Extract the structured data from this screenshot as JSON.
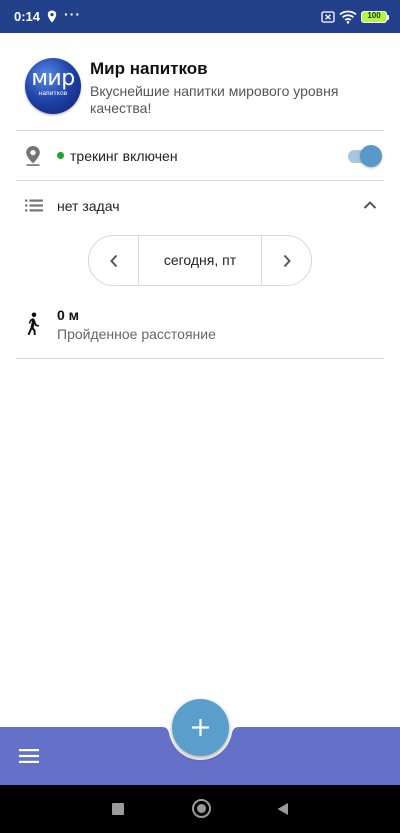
{
  "status_bar": {
    "time": "0:14",
    "more_dots": "···",
    "battery": "100"
  },
  "header": {
    "logo_text": "мир",
    "logo_subtext": "напитков",
    "title": "Мир напитков",
    "subtitle": "Вкуснейшие напитки мирового уровня качества!"
  },
  "tracking": {
    "label": "трекинг включен",
    "enabled": true,
    "status_color": "#1aa32a"
  },
  "tasks": {
    "label": "нет задач",
    "expanded": true
  },
  "date_nav": {
    "label": "сегодня, пт"
  },
  "distance": {
    "value": "0 м",
    "label": "Пройденное расстояние"
  },
  "colors": {
    "status_bar": "#23418b",
    "bottom_bar": "#6570c8",
    "accent": "#5a9fcb"
  },
  "icons": {
    "location": "map-pin-icon",
    "tasks": "list-icon",
    "distance": "walking-person-icon",
    "fab": "plus-icon",
    "menu": "hamburger-menu-icon"
  }
}
